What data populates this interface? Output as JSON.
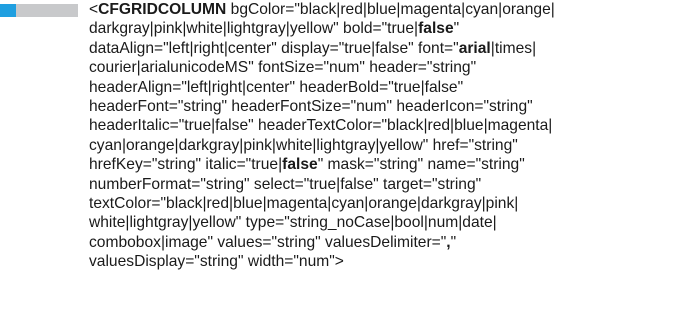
{
  "syntax": {
    "lines": [
      [
        {
          "text": "<"
        },
        {
          "text": "CFGRIDCOLUMN",
          "bold": true
        },
        {
          "text": " bgColor=\"black|red|blue|magenta|cyan|orange|"
        }
      ],
      [
        {
          "text": "darkgray|pink|white|lightgray|yellow\" bold=\"true|"
        },
        {
          "text": "false",
          "bold": true
        },
        {
          "text": "\""
        }
      ],
      [
        {
          "text": "dataAlign=\"left|right|center\" display=\"true|false\" font=\""
        },
        {
          "text": "arial",
          "bold": true
        },
        {
          "text": "|times|"
        }
      ],
      [
        {
          "text": "courier|arialunicodeMS\" fontSize=\"num\" header=\"string\""
        }
      ],
      [
        {
          "text": "headerAlign=\"left|right|center\" headerBold=\"true|false\""
        }
      ],
      [
        {
          "text": "headerFont=\"string\" headerFontSize=\"num\" headerIcon=\"string\""
        }
      ],
      [
        {
          "text": "headerItalic=\"true|false\" headerTextColor=\"black|red|blue|magenta|"
        }
      ],
      [
        {
          "text": "cyan|orange|darkgray|pink|white|lightgray|yellow\" href=\"string\""
        }
      ],
      [
        {
          "text": "hrefKey=\"string\" italic=\"true|"
        },
        {
          "text": "false",
          "bold": true
        },
        {
          "text": "\" mask=\"string\" name=\"string\""
        }
      ],
      [
        {
          "text": "numberFormat=\"string\" select=\"true|false\" target=\"string\""
        }
      ],
      [
        {
          "text": "textColor=\"black|red|blue|magenta|cyan|orange|darkgray|pink|"
        }
      ],
      [
        {
          "text": "white|lightgray|yellow\" type=\"string_noCase|bool|num|date|"
        }
      ],
      [
        {
          "text": "combobox|image\" values=\"string\" valuesDelimiter=\""
        },
        {
          "text": ",",
          "bold": true
        },
        {
          "text": "\""
        }
      ],
      [
        {
          "text": "valuesDisplay=\"string\" width=\"num\">"
        }
      ]
    ]
  },
  "marker": {
    "accent_color": "#1f9fe0",
    "bar_color": "#c8c9cb"
  }
}
